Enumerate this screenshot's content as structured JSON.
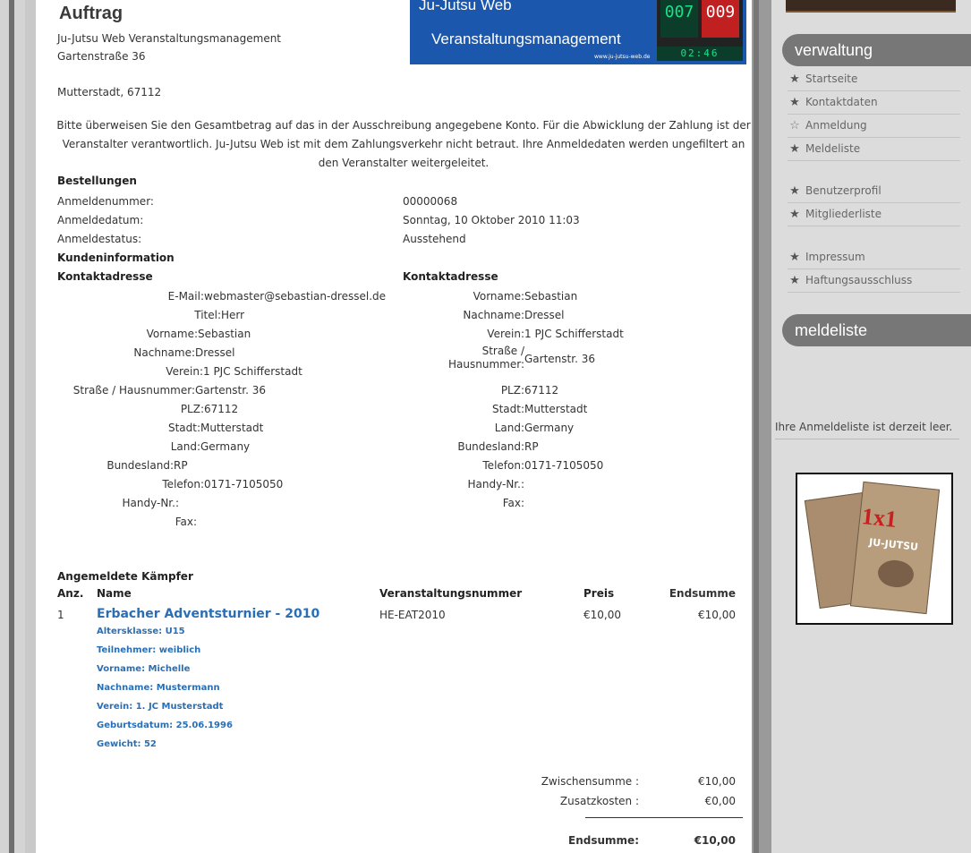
{
  "banner": {
    "title1": "Ju-Jutsu Web",
    "title2": "Veranstaltungsmanagement",
    "url": "www.ju-jutsu-web.de",
    "score_left": "007",
    "score_right": "009",
    "timer": "02:46"
  },
  "order": {
    "heading": "Auftrag",
    "company": "Ju-Jutsu Web Veranstaltungsmanagement",
    "street": "Gartenstraße 36",
    "city": "Mutterstadt, 67112",
    "notice": "Bitte überweisen Sie den Gesamtbetrag auf das in der Ausschreibung angegebene Konto. Für die Abwicklung der Zahlung ist der Veranstalter verantwortlich. Ju-Jutsu Web ist mit dem Zahlungsverkehr nicht betraut. Ihre Anmeldedaten werden ungefiltert an den Veranstalter weitergeleitet."
  },
  "bestellungen": {
    "heading": "Bestellungen",
    "rows": [
      {
        "label": "Anmeldenummer:",
        "value": "00000068"
      },
      {
        "label": "Anmeldedatum:",
        "value": "Sonntag, 10 Oktober 2010 11:03"
      },
      {
        "label": "Anmeldestatus:",
        "value": "Ausstehend"
      }
    ]
  },
  "kunden": {
    "heading": "Kundeninformation",
    "left_heading": "Kontaktadresse",
    "right_heading": "Kontaktadresse",
    "left": [
      {
        "label": "E-Mail:",
        "value": "webmaster@sebastian-dressel.de"
      },
      {
        "label": "Titel:",
        "value": "Herr"
      },
      {
        "label": "Vorname:",
        "value": "Sebastian"
      },
      {
        "label": "Nachname:",
        "value": "Dressel"
      },
      {
        "label": "Verein:",
        "value": "1 PJC Schifferstadt"
      },
      {
        "label": "Straße / Hausnummer:",
        "value": "Gartenstr. 36"
      },
      {
        "label": "PLZ:",
        "value": "67112"
      },
      {
        "label": "Stadt:",
        "value": "Mutterstadt"
      },
      {
        "label": "Land:",
        "value": "Germany"
      },
      {
        "label": "Bundesland:",
        "value": "RP"
      },
      {
        "label": "Telefon:",
        "value": "0171-7105050"
      },
      {
        "label": "Handy-Nr.:",
        "value": ""
      },
      {
        "label": "Fax:",
        "value": ""
      }
    ],
    "right": [
      {
        "label": "Vorname:",
        "value": "Sebastian"
      },
      {
        "label": "Nachname:",
        "value": "Dressel"
      },
      {
        "label": "Verein:",
        "value": "1 PJC Schifferstadt"
      },
      {
        "label": "Straße /",
        "label2": "Hausnummer:",
        "value": "Gartenstr. 36"
      },
      {
        "label": "PLZ:",
        "value": "67112"
      },
      {
        "label": "Stadt:",
        "value": "Mutterstadt"
      },
      {
        "label": "Land:",
        "value": "Germany"
      },
      {
        "label": "Bundesland:",
        "value": "RP"
      },
      {
        "label": "Telefon:",
        "value": "0171-7105050"
      },
      {
        "label": "Handy-Nr.:",
        "value": ""
      },
      {
        "label": "Fax:",
        "value": ""
      }
    ]
  },
  "fighters": {
    "heading": "Angemeldete Kämpfer",
    "col_anz": "Anz.",
    "col_name": "Name",
    "col_nummer": "Veranstaltungsnummer",
    "col_preis": "Preis",
    "col_endsumme": "Endsumme",
    "item": {
      "anz": "1",
      "name": "Erbacher Adventsturnier - 2010",
      "nummer": "HE-EAT2010",
      "preis": "€10,00",
      "endsumme": "€10,00",
      "details": [
        "Altersklasse: U15",
        "Teilnehmer: weiblich",
        "Vorname: Michelle",
        "Nachname: Mustermann",
        "Verein: 1. JC Musterstadt",
        "Geburtsdatum: 25.06.1996",
        "Gewicht: 52"
      ]
    }
  },
  "totals": {
    "zwischensumme_label": "Zwischensumme :",
    "zwischensumme": "€10,00",
    "zusatz_label": "Zusatzkosten :",
    "zusatz": "€0,00",
    "end_label": "Endsumme:",
    "end": "€10,00"
  },
  "sidebar": {
    "verwaltung": "verwaltung",
    "items": [
      {
        "label": "Startseite",
        "icon": "star-icon"
      },
      {
        "label": "Kontaktdaten",
        "icon": "star-icon"
      },
      {
        "label": "Anmeldung",
        "icon": "star-outline-icon"
      },
      {
        "label": "Meldeliste",
        "icon": "star-icon"
      },
      {
        "label": "Benutzerprofil",
        "icon": "star-icon"
      },
      {
        "label": "Mitgliederliste",
        "icon": "star-icon"
      },
      {
        "label": "Impressum",
        "icon": "star-icon"
      },
      {
        "label": "Haftungsausschluss",
        "icon": "star-icon"
      }
    ],
    "meldeliste": "meldeliste",
    "empty_note": "Ihre Anmeldeliste ist derzeit leer.",
    "book_title": "1x1",
    "book_subtitle": "JU-JUTSU"
  }
}
